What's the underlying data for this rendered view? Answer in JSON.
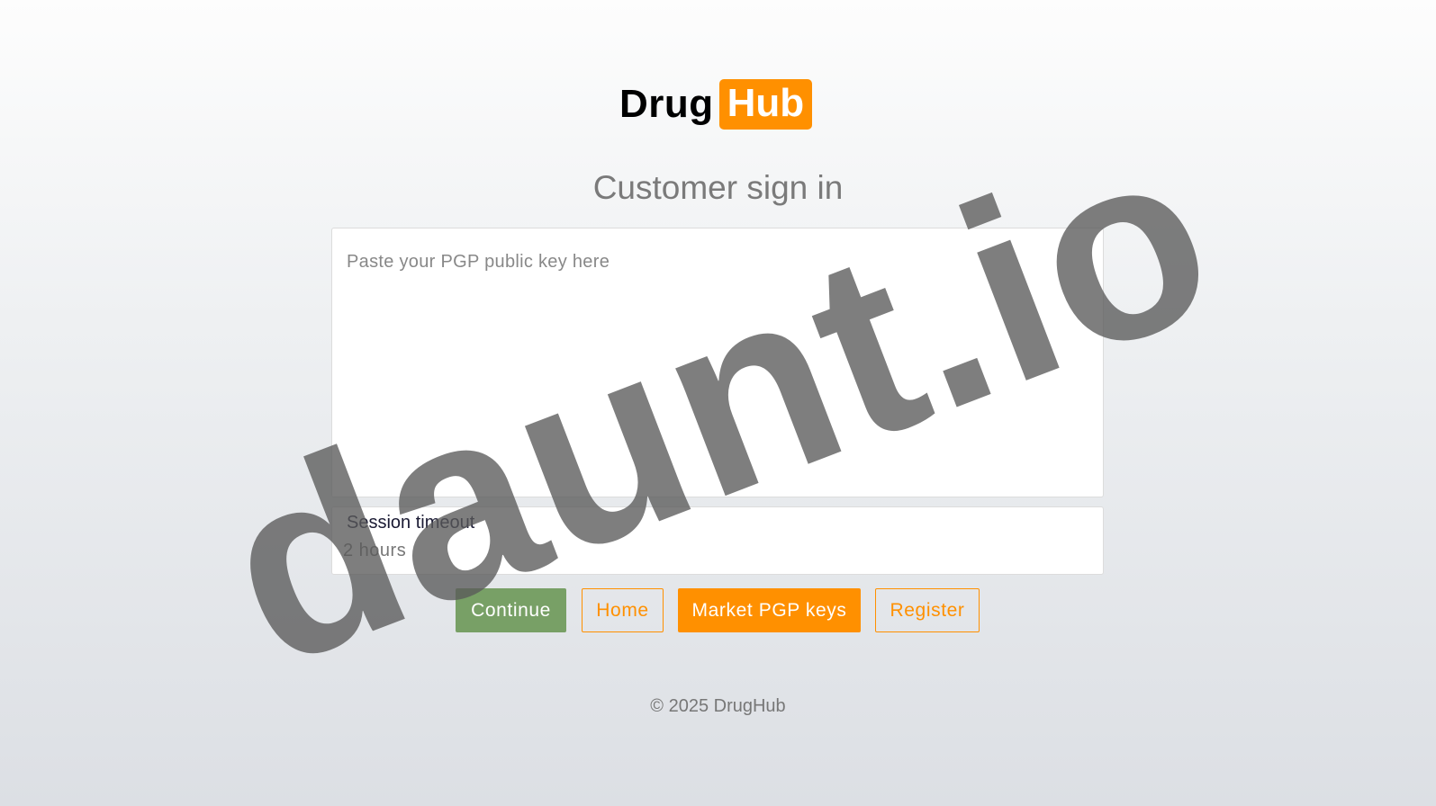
{
  "logo": {
    "part1": "Drug",
    "part2": "Hub"
  },
  "page_title": "Customer sign in",
  "pgp_input": {
    "placeholder": "Paste your PGP public key here",
    "value": ""
  },
  "session_timeout": {
    "label": "Session timeout",
    "value": "2 hours"
  },
  "buttons": {
    "continue": "Continue",
    "home": "Home",
    "market_pgp_keys": "Market PGP keys",
    "register": "Register"
  },
  "footer": "© 2025 DrugHub",
  "watermark": "daunt.io",
  "colors": {
    "brand_orange": "#ff9000",
    "continue_green": "#78a066",
    "title_gray": "#7a7a7a"
  }
}
